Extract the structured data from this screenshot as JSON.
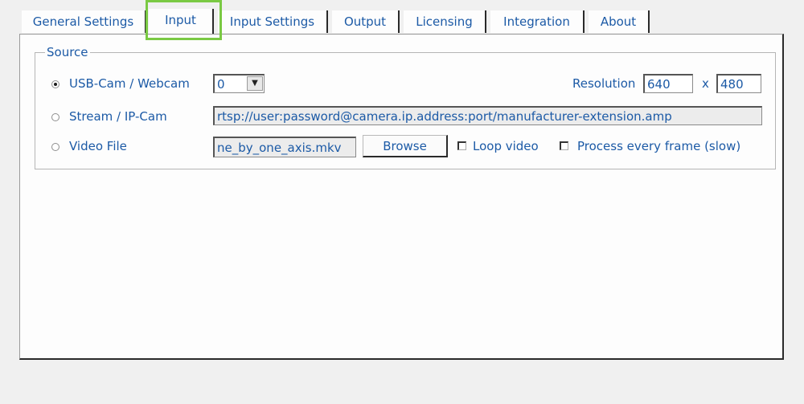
{
  "tabs": [
    "General Settings",
    "Input",
    "Input Settings",
    "Output",
    "Licensing",
    "Integration",
    "About"
  ],
  "active_tab": "Input",
  "highlight_color": "#7ac943",
  "accent_color": "#1c5aa6",
  "source": {
    "legend": "Source",
    "usb": {
      "label": "USB-Cam / Webcam",
      "device_value": "0",
      "selected": true
    },
    "resolution": {
      "label": "Resolution",
      "width": "640",
      "sep": "x",
      "height": "480"
    },
    "stream": {
      "label": "Stream / IP-Cam",
      "url": "rtsp://user:password@camera.ip.address:port/manufacturer-extension.amp"
    },
    "file": {
      "label": "Video File",
      "path": "ne_by_one_axis.mkv",
      "browse": "Browse",
      "loop": "Loop video",
      "process_all": "Process every frame (slow)"
    }
  }
}
